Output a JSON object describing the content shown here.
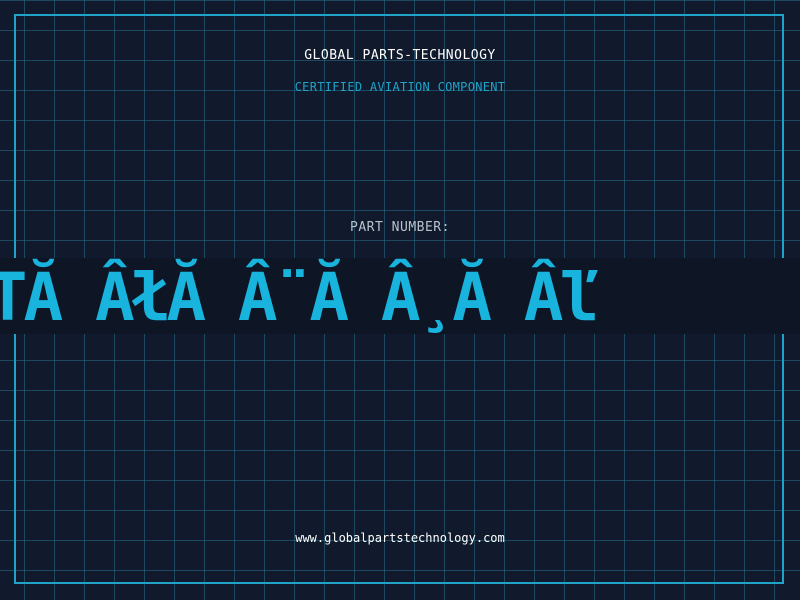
{
  "company": {
    "name": "GLOBAL PARTS-TECHNOLOGY"
  },
  "tagline": "CERTIFIED AVIATION COMPONENT",
  "part": {
    "label": "PART NUMBER:",
    "value": "TTĂ ÂłĂ Â¨Ă Â¸Ă Âľ"
  },
  "footer": {
    "website": "www.globalpartstechnology.com"
  },
  "colors": {
    "background": "#111a2c",
    "grid": "#266e8c",
    "accent": "#1fa3c8",
    "part_number": "#18b4de",
    "text": "#ffffff"
  }
}
